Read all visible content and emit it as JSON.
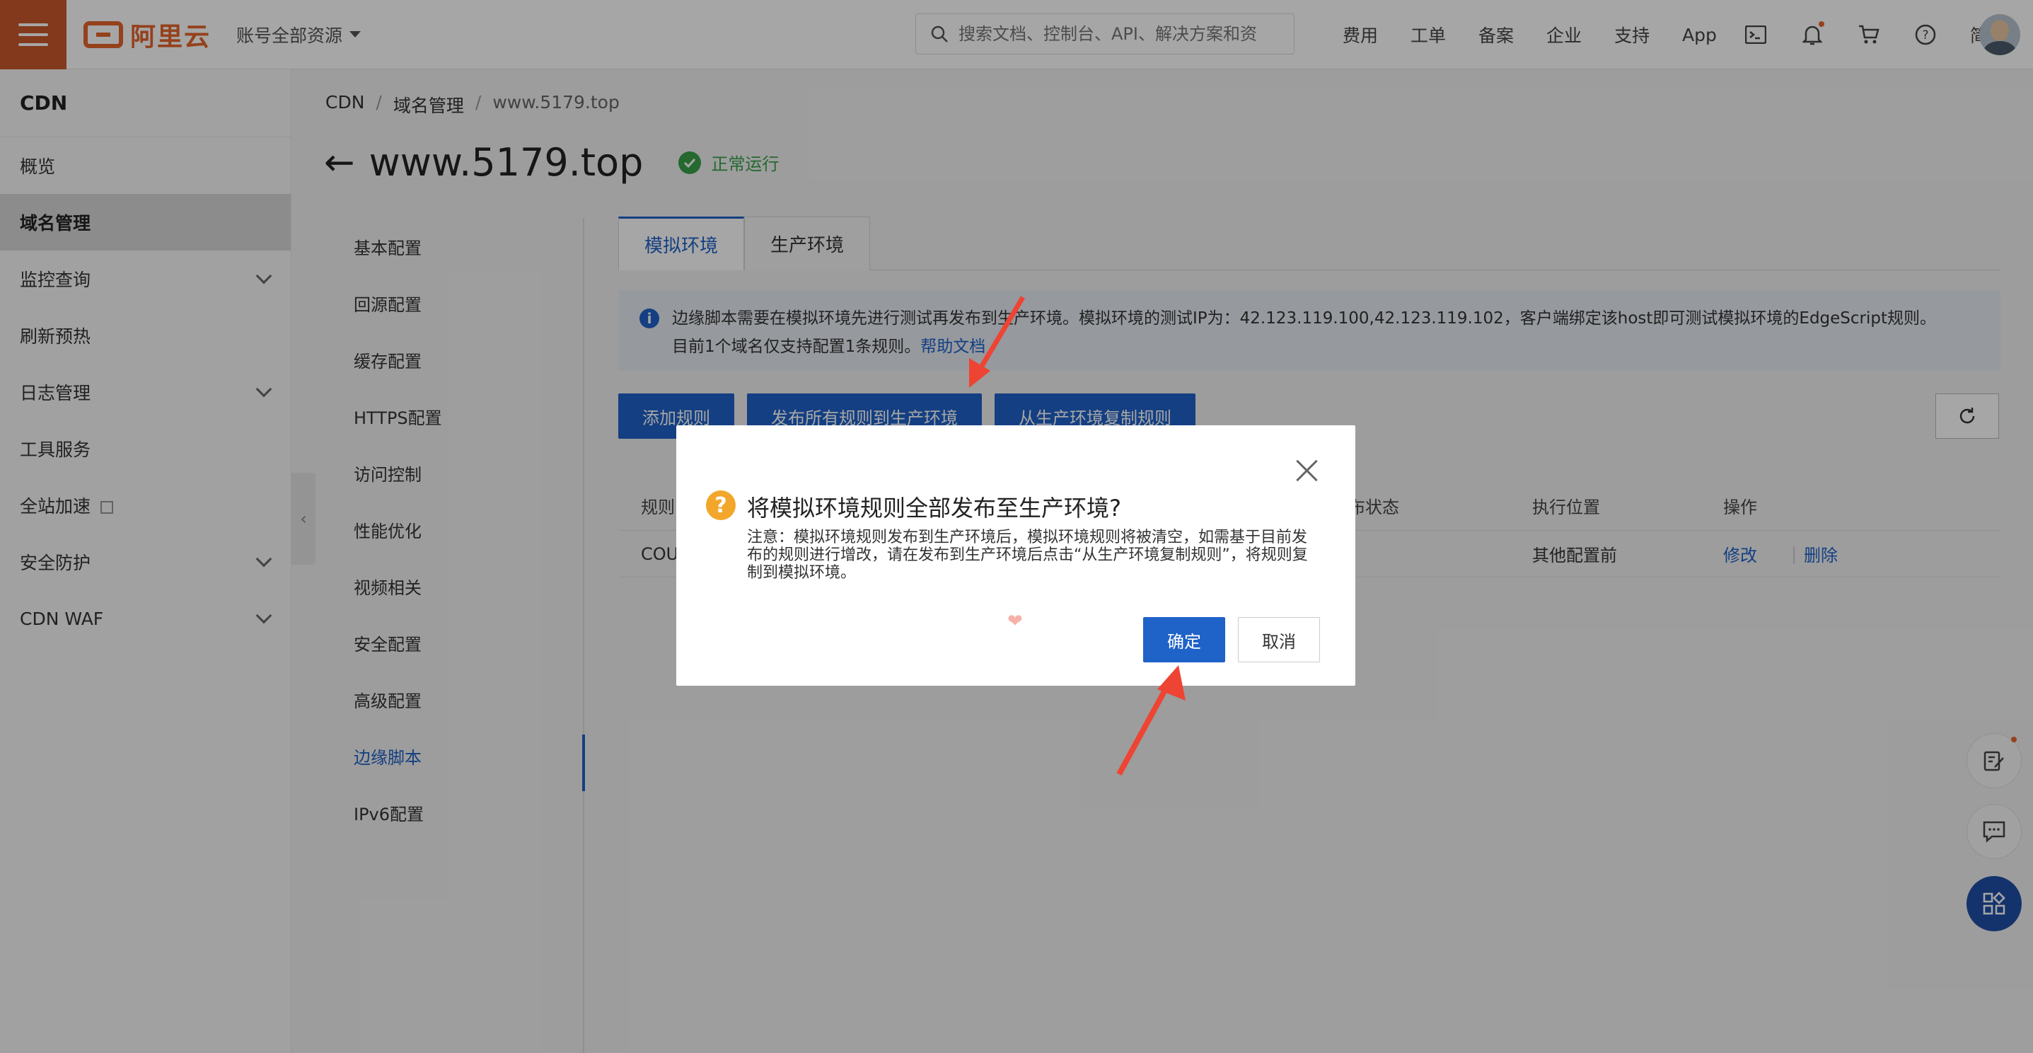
{
  "topbar": {
    "logo_text": "阿里云",
    "account_label": "账号全部资源",
    "search_placeholder": "搜索文档、控制台、API、解决方案和资",
    "nav": [
      "费用",
      "工单",
      "备案",
      "企业",
      "支持",
      "App"
    ],
    "language": "简体"
  },
  "sidebar": {
    "title": "CDN",
    "items": [
      {
        "label": "概览"
      },
      {
        "label": "域名管理"
      },
      {
        "label": "监控查询"
      },
      {
        "label": "刷新预热"
      },
      {
        "label": "日志管理"
      },
      {
        "label": "工具服务"
      },
      {
        "label": "全站加速"
      },
      {
        "label": "安全防护"
      },
      {
        "label": "CDN WAF"
      }
    ]
  },
  "breadcrumb": [
    "CDN",
    "域名管理",
    "www.5179.top"
  ],
  "page": {
    "title": "www.5179.top",
    "status": "正常运行"
  },
  "config_nav": [
    "基本配置",
    "回源配置",
    "缓存配置",
    "HTTPS配置",
    "访问控制",
    "性能优化",
    "视频相关",
    "安全配置",
    "高级配置",
    "边缘脚本",
    "IPv6配置"
  ],
  "tabs": [
    "模拟环境",
    "生产环境"
  ],
  "notice": {
    "line1": "边缘脚本需要在模拟环境先进行测试再发布到生产环境。模拟环境的测试IP为：42.123.119.100,42.123.119.102，客户端绑定该host即可测试模拟环境的EdgeScript规则。",
    "line2": "目前1个域名仅支持配置1条规则。",
    "link": "帮助文档"
  },
  "buttons": {
    "add_rule": "添加规则",
    "publish_all": "发布所有规则到生产环境",
    "copy_from_prod": "从生产环境复制规则"
  },
  "table": {
    "headers": {
      "rule": "规则",
      "publish_status": "布状态",
      "position": "执行位置",
      "action": "操作"
    },
    "rows": [
      {
        "rule": "COU",
        "position": "其他配置前",
        "edit": "修改",
        "delete": "删除"
      }
    ]
  },
  "dialog": {
    "title": "将模拟环境规则全部发布至生产环境?",
    "body": "注意：模拟环境规则发布到生产环境后，模拟环境规则将被清空，如需基于目前发布的规则进行增改，请在发布到生产环境后点击“从生产环境复制规则”，将规则复制到模拟环境。",
    "ok": "确定",
    "cancel": "取消"
  },
  "colors": {
    "brand": "#e5642b",
    "primary": "#1f62c8",
    "success": "#3aa14b",
    "warning": "#f2a72b",
    "annotation_arrow": "#ee4433"
  }
}
